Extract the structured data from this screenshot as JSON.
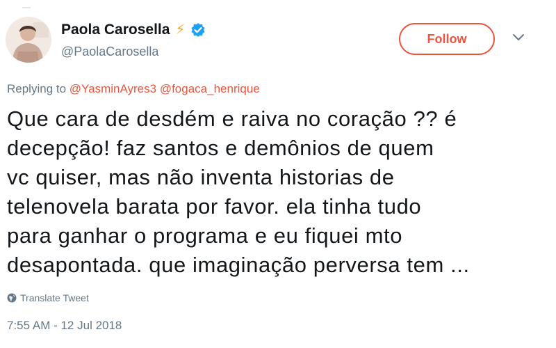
{
  "author": {
    "name": "Paola Carosella",
    "handle": "@PaolaCarosella",
    "emoji": "⚡",
    "verified": true
  },
  "follow_button": {
    "label": "Follow"
  },
  "reply": {
    "prefix": "Replying to",
    "mentions": [
      "@YasminAyres3",
      "@fogaca_henrique"
    ]
  },
  "tweet": {
    "lines": [
      "Que cara de desdém e raiva no coração ?? é",
      "decepção!  faz santos e demônios de quem",
      "vc quiser, mas não inventa historias de",
      "telenovela barata por favor. ela tinha tudo",
      "para ganhar o programa e eu fiquei mto",
      "desapontada. que imaginação perversa tem ..."
    ]
  },
  "translate": {
    "label": "Translate Tweet"
  },
  "timestamp": "7:55 AM - 12 Jul 2018",
  "colors": {
    "accent": "#e8573f",
    "verified": "#1da1f2",
    "muted": "#657786",
    "text": "#14171a"
  }
}
